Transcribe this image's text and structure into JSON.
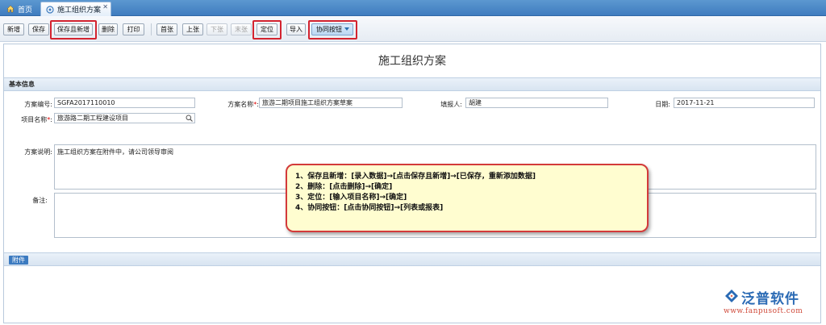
{
  "tabs": {
    "home_label": "首页",
    "active_label": "施工组织方案"
  },
  "toolbar": {
    "new": "新增",
    "save": "保存",
    "save_and_new": "保存且新增",
    "delete": "删除",
    "print": "打印",
    "first": "首张",
    "prev": "上张",
    "next": "下张",
    "last": "末张",
    "locate": "定位",
    "import": "导入",
    "collab": "协同按钮"
  },
  "page": {
    "title": "施工组织方案",
    "basic_info_header": "基本信息",
    "attachment_button": "附件"
  },
  "form": {
    "plan_no_label": "方案编号:",
    "plan_no_value": "SGFA2017110010",
    "plan_name_label": "方案名称",
    "plan_name_value": "旅游二期项目施工组织方案草案",
    "reporter_label": "填报人:",
    "reporter_value": "胡建",
    "date_label": "日期:",
    "date_value": "2017-11-21",
    "project_label": "项目名称",
    "project_value": "旅游路二期工程建设项目",
    "desc_label": "方案说明:",
    "desc_value": "施工组织方案在附件中，请公司领导审阅",
    "remark_label": "备注:",
    "remark_value": "",
    "required_mark": "*",
    "colon": ":"
  },
  "callout": {
    "line1": "1、保存且新增：[录入数据]→[点击保存且新增]→[已保存，重新添加数据]",
    "line2": "2、删除：[点击删除]→[确定]",
    "line3": "3、定位：[输入项目名称]→[确定]",
    "line4": "4、协同按钮：[点击协同按钮]→[列表或报表]"
  },
  "logo": {
    "name": "泛普软件",
    "url": "www.fanpusoft.com"
  },
  "colors": {
    "accent": "#3f7cbf",
    "highlight": "#d3232f",
    "callout_bg": "#fffdd0"
  }
}
